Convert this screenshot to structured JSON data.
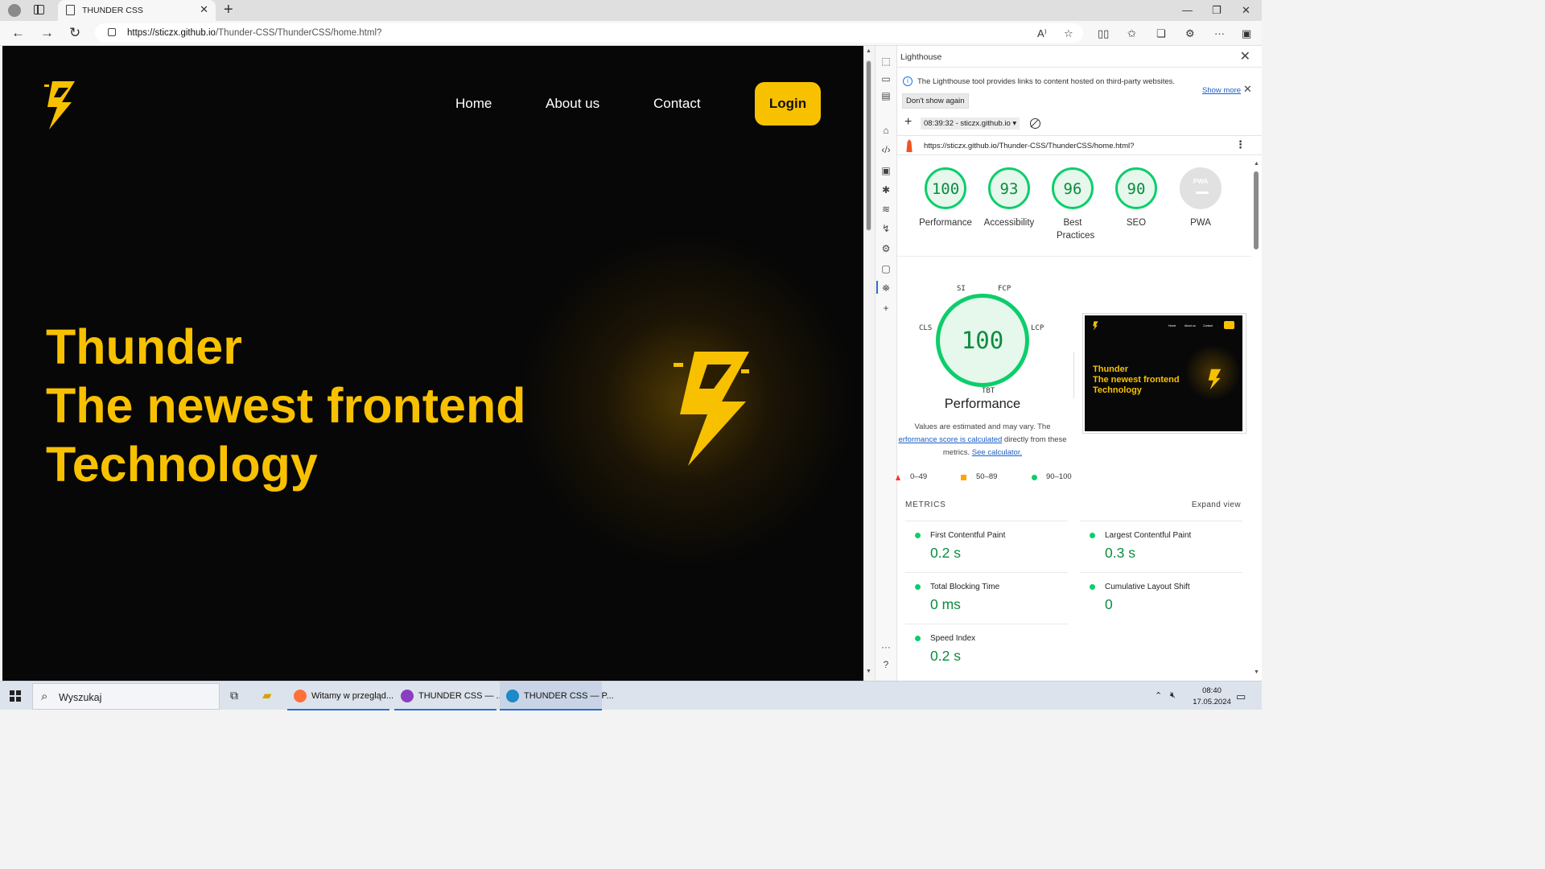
{
  "browser": {
    "tab_title": "THUNDER CSS",
    "url_host": "https://sticzx.github.io",
    "url_path": "/Thunder-CSS/ThunderCSS/home.html?"
  },
  "site": {
    "nav": [
      "Home",
      "About us",
      "Contact"
    ],
    "login": "Login",
    "hero_lines": [
      "Thunder",
      "The newest frontend",
      "Technology"
    ],
    "brand_color": "#f8c100"
  },
  "devtools": {
    "panel_title": "Lighthouse",
    "info_text": "The Lighthouse tool provides links to content hosted on third-party websites.",
    "show_more": "Show more",
    "dont_show": "Don't show again",
    "report_select": "08:39:32 - sticzx.github.io",
    "report_url": "https://sticzx.github.io/Thunder-CSS/ThunderCSS/home.html?",
    "scores": [
      {
        "value": "100",
        "label": "Performance"
      },
      {
        "value": "93",
        "label": "Accessibility"
      },
      {
        "value": "96",
        "label": "Best Practices"
      },
      {
        "value": "90",
        "label": "SEO"
      },
      {
        "value": "PWA",
        "label": "PWA"
      }
    ],
    "perf": {
      "score": "100",
      "title": "Performance",
      "segments": {
        "si": "SI",
        "fcp": "FCP",
        "lcp": "LCP",
        "cls": "CLS",
        "tbt": "TBT"
      },
      "desc_1": "Values are estimated and may vary. The",
      "desc_link_1": "erformance score is calculated",
      "desc_2": " directly from these",
      "desc_3": "metrics. ",
      "desc_link_2": "See calculator.",
      "thumb_lines": [
        "Thunder",
        "The newest frontend",
        "Technology"
      ]
    },
    "legend": [
      "0–49",
      "50–89",
      "90–100"
    ],
    "metrics_title": "METRICS",
    "expand": "Expand view",
    "metrics": [
      {
        "name": "First Contentful Paint",
        "value": "0.2 s"
      },
      {
        "name": "Largest Contentful Paint",
        "value": "0.3 s"
      },
      {
        "name": "Total Blocking Time",
        "value": "0 ms"
      },
      {
        "name": "Cumulative Layout Shift",
        "value": "0"
      },
      {
        "name": "Speed Index",
        "value": "0.2 s"
      }
    ],
    "status_color_good": "#0cce6b"
  },
  "taskbar": {
    "search_placeholder": "Wyszukaj",
    "apps": [
      {
        "label": "Witamy w przegląd..."
      },
      {
        "label": "THUNDER CSS — ..."
      },
      {
        "label": "THUNDER CSS — P..."
      }
    ],
    "time": "08:40",
    "date": "17.05.2024"
  }
}
